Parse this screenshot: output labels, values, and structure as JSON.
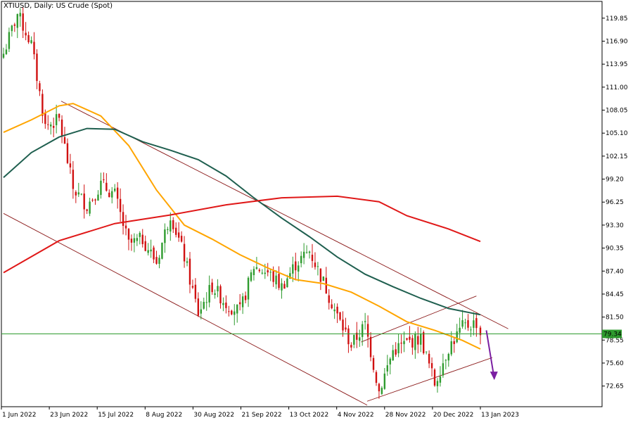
{
  "chart_data": {
    "type": "line",
    "title": "XTIUSD, Daily:  US Crude (Spot)",
    "ylim": [
      70.0,
      122.0
    ],
    "y_ticks": [
      "119.85",
      "116.90",
      "113.95",
      "111.00",
      "108.05",
      "105.10",
      "102.15",
      "99.20",
      "96.25",
      "93.30",
      "90.35",
      "87.40",
      "84.45",
      "81.50",
      "78.55",
      "75.60",
      "72.65"
    ],
    "x_ticks": [
      "1 Jun 2022",
      "23 Jun 2022",
      "15 Jul 2022",
      "8 Aug 2022",
      "30 Aug 2022",
      "21 Sep 2022",
      "13 Oct 2022",
      "4 Nov 2022",
      "28 Nov 2022",
      "20 Dec 2022",
      "13 Jan 2023"
    ],
    "current_price": "79.34",
    "candles": [
      {
        "d": "2022-06-01",
        "c": 115.3
      },
      {
        "d": "2022-06-08",
        "c": 120.4
      },
      {
        "d": "2022-06-15",
        "c": 116.5
      },
      {
        "d": "2022-06-22",
        "c": 106.0
      },
      {
        "d": "2022-06-29",
        "c": 106.8
      },
      {
        "d": "2022-07-06",
        "c": 98.0
      },
      {
        "d": "2022-07-13",
        "c": 95.8
      },
      {
        "d": "2022-07-20",
        "c": 98.5
      },
      {
        "d": "2022-07-27",
        "c": 97.2
      },
      {
        "d": "2022-08-03",
        "c": 90.8
      },
      {
        "d": "2022-08-10",
        "c": 91.5
      },
      {
        "d": "2022-08-17",
        "c": 88.5
      },
      {
        "d": "2022-08-24",
        "c": 94.8
      },
      {
        "d": "2022-08-31",
        "c": 89.2
      },
      {
        "d": "2022-09-07",
        "c": 82.0
      },
      {
        "d": "2022-09-14",
        "c": 85.5
      },
      {
        "d": "2022-09-21",
        "c": 83.2
      },
      {
        "d": "2022-09-28",
        "c": 82.2
      },
      {
        "d": "2022-10-05",
        "c": 88.0
      },
      {
        "d": "2022-10-12",
        "c": 87.2
      },
      {
        "d": "2022-10-19",
        "c": 85.4
      },
      {
        "d": "2022-10-26",
        "c": 88.3
      },
      {
        "d": "2022-11-02",
        "c": 90.0
      },
      {
        "d": "2022-11-09",
        "c": 86.0
      },
      {
        "d": "2022-11-16",
        "c": 81.6
      },
      {
        "d": "2022-11-23",
        "c": 77.9
      },
      {
        "d": "2022-11-30",
        "c": 80.5
      },
      {
        "d": "2022-12-07",
        "c": 72.0
      },
      {
        "d": "2022-12-14",
        "c": 77.2
      },
      {
        "d": "2022-12-21",
        "c": 78.2
      },
      {
        "d": "2022-12-28",
        "c": 78.8
      },
      {
        "d": "2023-01-04",
        "c": 73.0
      },
      {
        "d": "2023-01-11",
        "c": 77.6
      },
      {
        "d": "2023-01-18",
        "c": 80.2
      },
      {
        "d": "2023-01-25",
        "c": 80.8
      },
      {
        "d": "2023-01-27",
        "c": 79.34
      }
    ],
    "series": [
      {
        "color": "#FFA500",
        "values": [
          [
            "2022-06-01",
            105.2
          ],
          [
            "2022-06-15",
            106.8
          ],
          [
            "2022-06-29",
            108.6
          ],
          [
            "2022-07-06",
            108.9
          ],
          [
            "2022-07-20",
            107.3
          ],
          [
            "2022-08-03",
            103.5
          ],
          [
            "2022-08-17",
            97.8
          ],
          [
            "2022-08-31",
            93.3
          ],
          [
            "2022-09-14",
            91.5
          ],
          [
            "2022-09-28",
            89.5
          ],
          [
            "2022-10-12",
            87.8
          ],
          [
            "2022-10-26",
            86.3
          ],
          [
            "2022-11-09",
            85.8
          ],
          [
            "2022-11-23",
            84.7
          ],
          [
            "2022-12-07",
            82.9
          ],
          [
            "2022-12-21",
            80.9
          ],
          [
            "2023-01-04",
            79.8
          ],
          [
            "2023-01-18",
            78.5
          ],
          [
            "2023-01-27",
            77.4
          ]
        ]
      },
      {
        "color": "#1F5F4F",
        "values": [
          [
            "2022-06-01",
            99.4
          ],
          [
            "2022-06-15",
            102.6
          ],
          [
            "2022-06-29",
            104.6
          ],
          [
            "2022-07-13",
            105.7
          ],
          [
            "2022-07-27",
            105.6
          ],
          [
            "2022-08-10",
            104.0
          ],
          [
            "2022-08-24",
            102.9
          ],
          [
            "2022-09-07",
            101.7
          ],
          [
            "2022-09-21",
            99.6
          ],
          [
            "2022-10-05",
            96.8
          ],
          [
            "2022-10-19",
            94.2
          ],
          [
            "2022-11-02",
            91.8
          ],
          [
            "2022-11-16",
            89.2
          ],
          [
            "2022-11-30",
            87.0
          ],
          [
            "2022-12-14",
            85.4
          ],
          [
            "2022-12-28",
            83.9
          ],
          [
            "2023-01-11",
            82.6
          ],
          [
            "2023-01-27",
            81.8
          ]
        ]
      },
      {
        "color": "#E01818",
        "values": [
          [
            "2022-06-01",
            87.2
          ],
          [
            "2022-06-29",
            91.3
          ],
          [
            "2022-07-27",
            93.5
          ],
          [
            "2022-08-24",
            94.6
          ],
          [
            "2022-09-21",
            95.9
          ],
          [
            "2022-10-19",
            96.8
          ],
          [
            "2022-11-16",
            97.0
          ],
          [
            "2022-12-07",
            96.3
          ],
          [
            "2022-12-21",
            94.5
          ],
          [
            "2023-01-11",
            92.8
          ],
          [
            "2023-01-27",
            91.2
          ]
        ]
      }
    ]
  }
}
